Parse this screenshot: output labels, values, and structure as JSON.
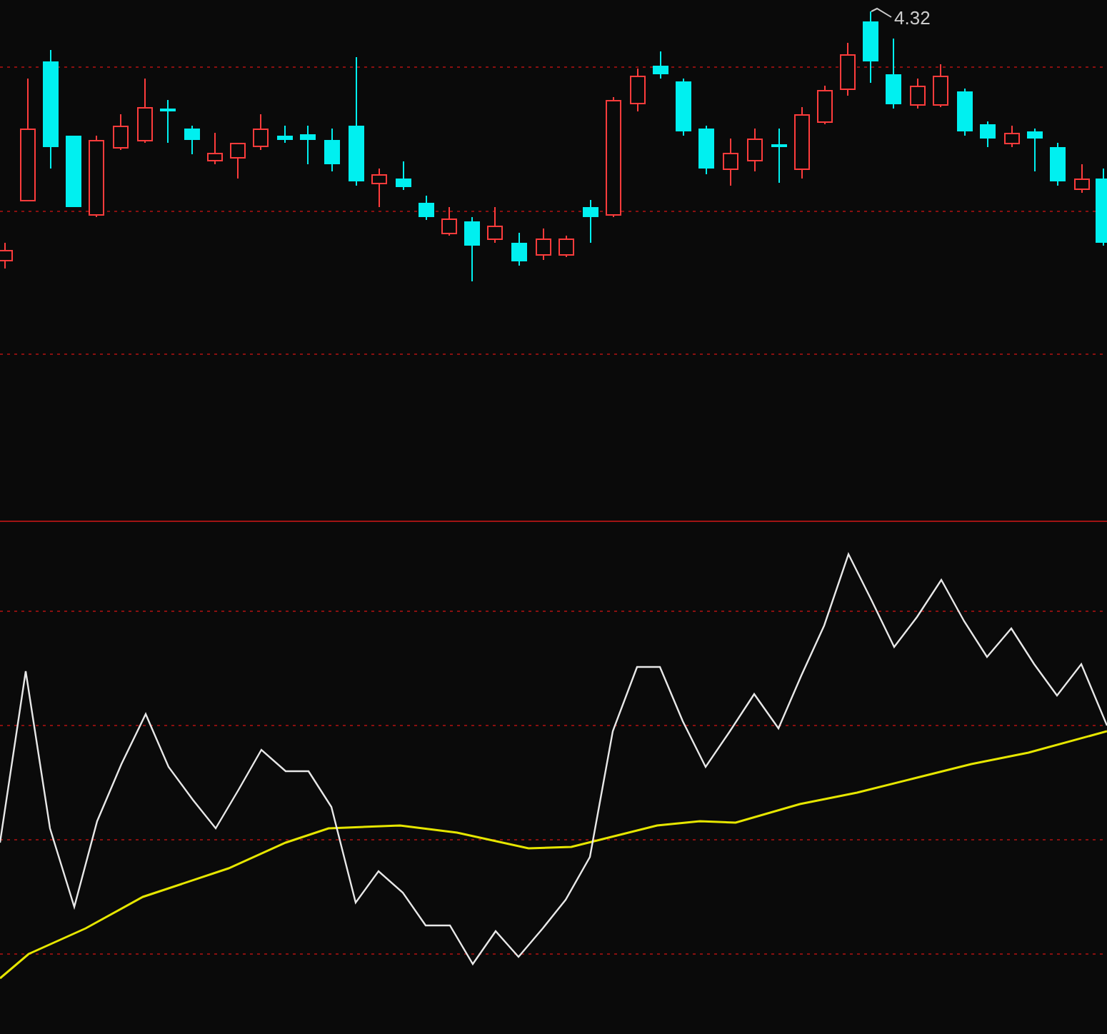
{
  "price_chart": {
    "high_label": "4.32"
  }
}
